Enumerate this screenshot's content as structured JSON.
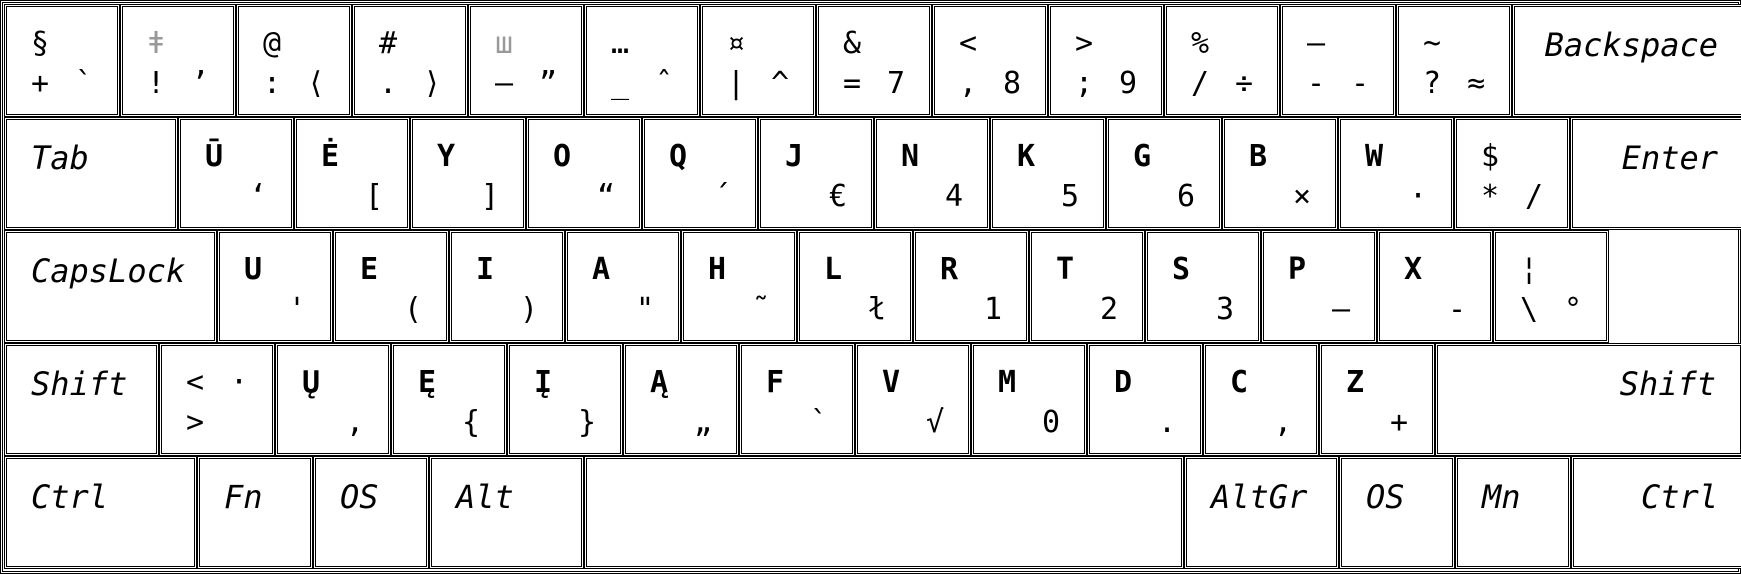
{
  "colors": {
    "background": "#ffffff",
    "border": "#000000",
    "text": "#000000",
    "muted": "#999999"
  },
  "rows": [
    [
      {
        "tl": "§",
        "bl": "+",
        "br": "`"
      },
      {
        "tl": "ǂ",
        "bl": "!",
        "br": "’",
        "tl_muted": true
      },
      {
        "tl": "@",
        "bl": ":",
        "br": "⟨"
      },
      {
        "tl": "#",
        "bl": ".",
        "br": "⟩"
      },
      {
        "tl": "ш",
        "bl": "—",
        "br": "”",
        "tl_muted": true
      },
      {
        "tl": "…",
        "bl": "_",
        "br": "ˆ"
      },
      {
        "tl": "¤",
        "bl": "|",
        "br": "^"
      },
      {
        "tl": "&",
        "bl": "=",
        "br": "7"
      },
      {
        "tl": "<",
        "bl": ",",
        "br": "8"
      },
      {
        "tl": ">",
        "bl": ";",
        "br": "9"
      },
      {
        "tl": "%",
        "bl": "/",
        "br": "÷"
      },
      {
        "tl": "—",
        "bl": "-",
        "br": "-"
      },
      {
        "tl": "~",
        "bl": "?",
        "br": "≈"
      },
      {
        "name": "Backspace",
        "align": "right"
      }
    ],
    [
      {
        "name": "Tab",
        "align": "left"
      },
      {
        "tl": "Ū",
        "br": "‘"
      },
      {
        "tl": "Ė",
        "br": "["
      },
      {
        "tl": "Y",
        "br": "]"
      },
      {
        "tl": "O",
        "br": "“"
      },
      {
        "tl": "Q",
        "br": "´"
      },
      {
        "tl": "J",
        "br": "€"
      },
      {
        "tl": "N",
        "br": "4"
      },
      {
        "tl": "K",
        "br": "5"
      },
      {
        "tl": "G",
        "br": "6"
      },
      {
        "tl": "B",
        "br": "×"
      },
      {
        "tl": "W",
        "br": "·"
      },
      {
        "tl": "$",
        "bl": "*",
        "br": "/"
      },
      {
        "name": "Enter",
        "align": "right"
      }
    ],
    [
      {
        "name": "CapsLock",
        "align": "left"
      },
      {
        "tl": "U",
        "br": "'"
      },
      {
        "tl": "E",
        "br": "("
      },
      {
        "tl": "I",
        "br": ")"
      },
      {
        "tl": "A",
        "br": "\""
      },
      {
        "tl": "H",
        "br": "˜"
      },
      {
        "tl": "L",
        "br": "ł"
      },
      {
        "tl": "R",
        "br": "1"
      },
      {
        "tl": "T",
        "br": "2"
      },
      {
        "tl": "S",
        "br": "3"
      },
      {
        "tl": "P",
        "br": "–"
      },
      {
        "tl": "X",
        "br": "-"
      },
      {
        "tl": "¦",
        "bl": "\\",
        "br": "°"
      }
    ],
    [
      {
        "name": "Shift",
        "align": "left"
      },
      {
        "tl": "<",
        "bl": ">",
        "tr": "·"
      },
      {
        "tl": "Ų",
        "br": ","
      },
      {
        "tl": "Ę",
        "br": "{"
      },
      {
        "tl": "Į",
        "br": "}"
      },
      {
        "tl": "Ą",
        "br": "„"
      },
      {
        "tl": "F",
        "br": "`"
      },
      {
        "tl": "V",
        "br": "√"
      },
      {
        "tl": "M",
        "br": "0"
      },
      {
        "tl": "D",
        "br": "."
      },
      {
        "tl": "C",
        "br": ","
      },
      {
        "tl": "Z",
        "br": "+"
      },
      {
        "name": "Shift",
        "align": "right"
      }
    ],
    [
      {
        "name": "Ctrl",
        "align": "left"
      },
      {
        "name": "Fn",
        "align": "left"
      },
      {
        "name": "OS",
        "align": "left"
      },
      {
        "name": "Alt",
        "align": "left"
      },
      {
        "name": "",
        "align": "left"
      },
      {
        "name": "AltGr",
        "align": "left"
      },
      {
        "name": "OS",
        "align": "left"
      },
      {
        "name": "Mn",
        "align": "left"
      },
      {
        "name": "Ctrl",
        "align": "right"
      }
    ]
  ]
}
